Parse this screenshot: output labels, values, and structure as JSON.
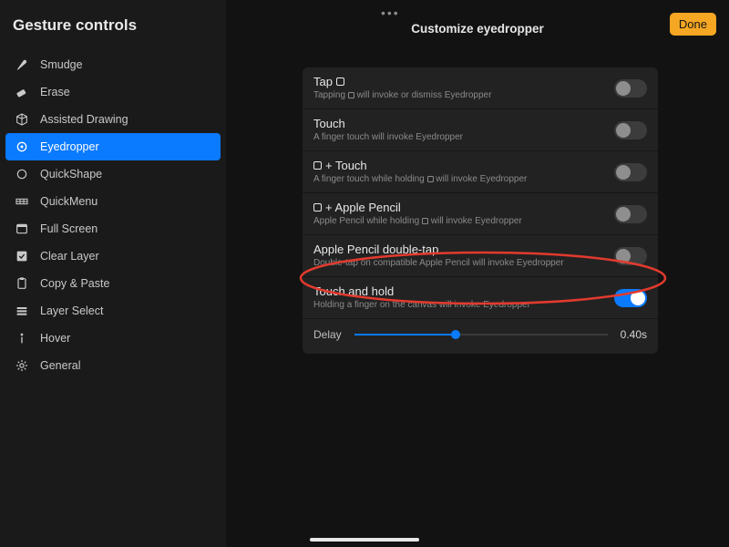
{
  "sidebar": {
    "title": "Gesture controls",
    "items": [
      {
        "label": "Smudge"
      },
      {
        "label": "Erase"
      },
      {
        "label": "Assisted Drawing"
      },
      {
        "label": "Eyedropper"
      },
      {
        "label": "QuickShape"
      },
      {
        "label": "QuickMenu"
      },
      {
        "label": "Full Screen"
      },
      {
        "label": "Clear Layer"
      },
      {
        "label": "Copy & Paste"
      },
      {
        "label": "Layer Select"
      },
      {
        "label": "Hover"
      },
      {
        "label": "General"
      }
    ]
  },
  "header": {
    "title": "Customize eyedropper",
    "done": "Done"
  },
  "options": {
    "tap": {
      "title_before": "Tap ",
      "sub_before": "Tapping ",
      "sub_after": " will invoke or dismiss Eyedropper",
      "on": false
    },
    "touch": {
      "title": "Touch",
      "sub": "A finger touch will invoke Eyedropper",
      "on": false
    },
    "sq_touch": {
      "title_after": " + Touch",
      "sub_before": "A finger touch while holding ",
      "sub_after": " will invoke Eyedropper",
      "on": false
    },
    "sq_pencil": {
      "title_after": " + Apple Pencil",
      "sub_before": "Apple Pencil while holding ",
      "sub_after": " will invoke Eyedropper",
      "on": false
    },
    "dbl_tap": {
      "title": "Apple Pencil double-tap",
      "sub": "Double-tap on compatible Apple Pencil will invoke Eyedropper",
      "on": false
    },
    "hold": {
      "title": "Touch and hold",
      "sub": "Holding a finger on the canvas will invoke Eyedropper",
      "on": true
    }
  },
  "delay": {
    "label": "Delay",
    "value": "0.40s",
    "fraction": 0.4
  },
  "colors": {
    "accent": "#0a7aff",
    "done_bg": "#f5a623",
    "annotation": "#e23a2e"
  }
}
